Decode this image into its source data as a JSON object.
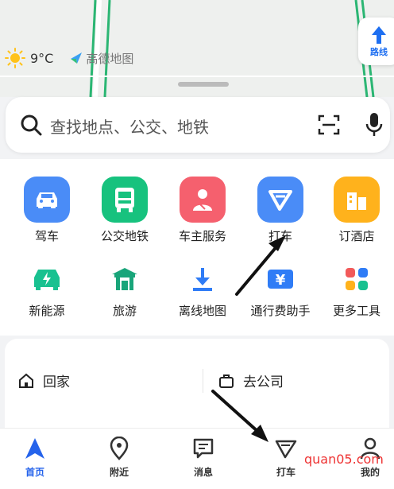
{
  "weather": {
    "temperature": "9°C",
    "icon": "sun-icon"
  },
  "brand": {
    "name": "高德地图"
  },
  "route_button": {
    "label": "路线"
  },
  "search": {
    "placeholder": "查找地点、公交、地铁"
  },
  "services": {
    "row1": [
      {
        "label": "驾车",
        "icon": "car-icon",
        "color": "#4a8cf7"
      },
      {
        "label": "公交地铁",
        "icon": "bus-icon",
        "color": "#17c27e"
      },
      {
        "label": "车主服务",
        "icon": "driver-icon",
        "color": "#f5606e"
      },
      {
        "label": "打车",
        "icon": "taxi-icon",
        "color": "#4a8cf7"
      },
      {
        "label": "订酒店",
        "icon": "hotel-icon",
        "color": "#ffb21c"
      }
    ],
    "row2": [
      {
        "label": "新能源",
        "icon": "ev-charging-icon",
        "color": "#19c190"
      },
      {
        "label": "旅游",
        "icon": "travel-icon",
        "color": "#19a57a"
      },
      {
        "label": "离线地图",
        "icon": "download-icon",
        "color": "#2f7cf6"
      },
      {
        "label": "通行费助手",
        "icon": "toll-icon",
        "color": "#2f7cf6"
      },
      {
        "label": "更多工具",
        "icon": "more-tools-icon",
        "color": "#f25a5a"
      }
    ]
  },
  "quick": {
    "home": "回家",
    "company": "去公司"
  },
  "tabs": [
    {
      "label": "首页",
      "icon": "home-nav-icon"
    },
    {
      "label": "附近",
      "icon": "nearby-icon"
    },
    {
      "label": "消息",
      "icon": "message-icon"
    },
    {
      "label": "打车",
      "icon": "taxi-tab-icon"
    },
    {
      "label": "我的",
      "icon": "profile-icon"
    }
  ],
  "watermark": "quan05.com"
}
